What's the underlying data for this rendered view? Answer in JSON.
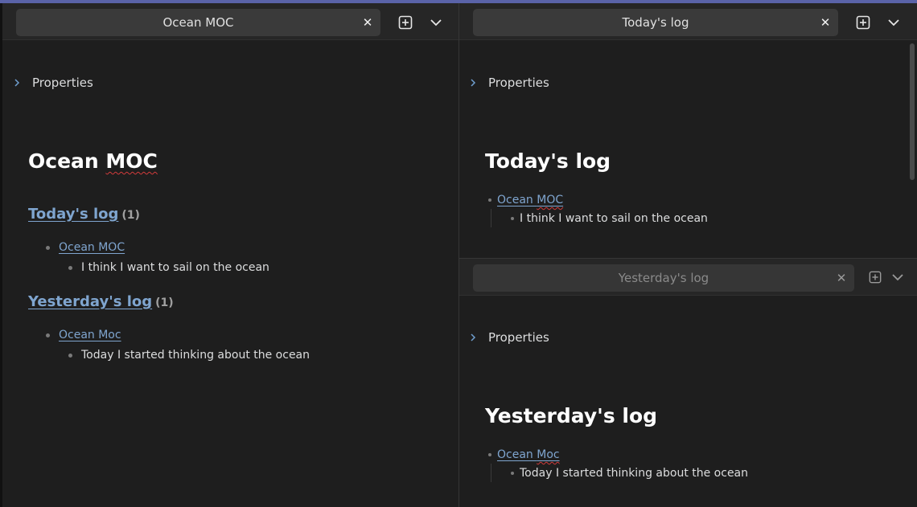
{
  "left_pane": {
    "tab": {
      "title": "Ocean MOC",
      "close_icon": "close-icon"
    },
    "properties_label": "Properties",
    "title": "Ocean MOC",
    "title_part_plain": "Ocean ",
    "title_part_flagged": "MOC",
    "groups": [
      {
        "heading": "Today's log",
        "count": "(1)",
        "link": "Ocean MOC",
        "text": "I think I want to sail on the ocean"
      },
      {
        "heading": "Yesterday's log",
        "count": "(1)",
        "link": "Ocean Moc",
        "text": "Today I started thinking about the ocean"
      }
    ]
  },
  "right_top_pane": {
    "tab": {
      "title": "Today's log"
    },
    "properties_label": "Properties",
    "title": "Today's log",
    "link_part_plain": "Ocean ",
    "link_part_flagged": "MOC",
    "text": "I think I want to sail on the ocean"
  },
  "right_bottom_pane": {
    "tab": {
      "title": "Yesterday's log"
    },
    "properties_label": "Properties",
    "title": "Yesterday's log",
    "link_part_plain": "Ocean ",
    "link_part_flagged": "Moc",
    "text": "Today I started thinking about the ocean"
  },
  "colors": {
    "accent": "#5a63a8",
    "link": "#7fa5cf",
    "background": "#1e1e1e",
    "spellcheck": "#d23b3b"
  },
  "icons": {
    "new_tab": "new-tab-icon",
    "dropdown": "chevron-down-icon",
    "collapse": "chevron-right-icon"
  }
}
